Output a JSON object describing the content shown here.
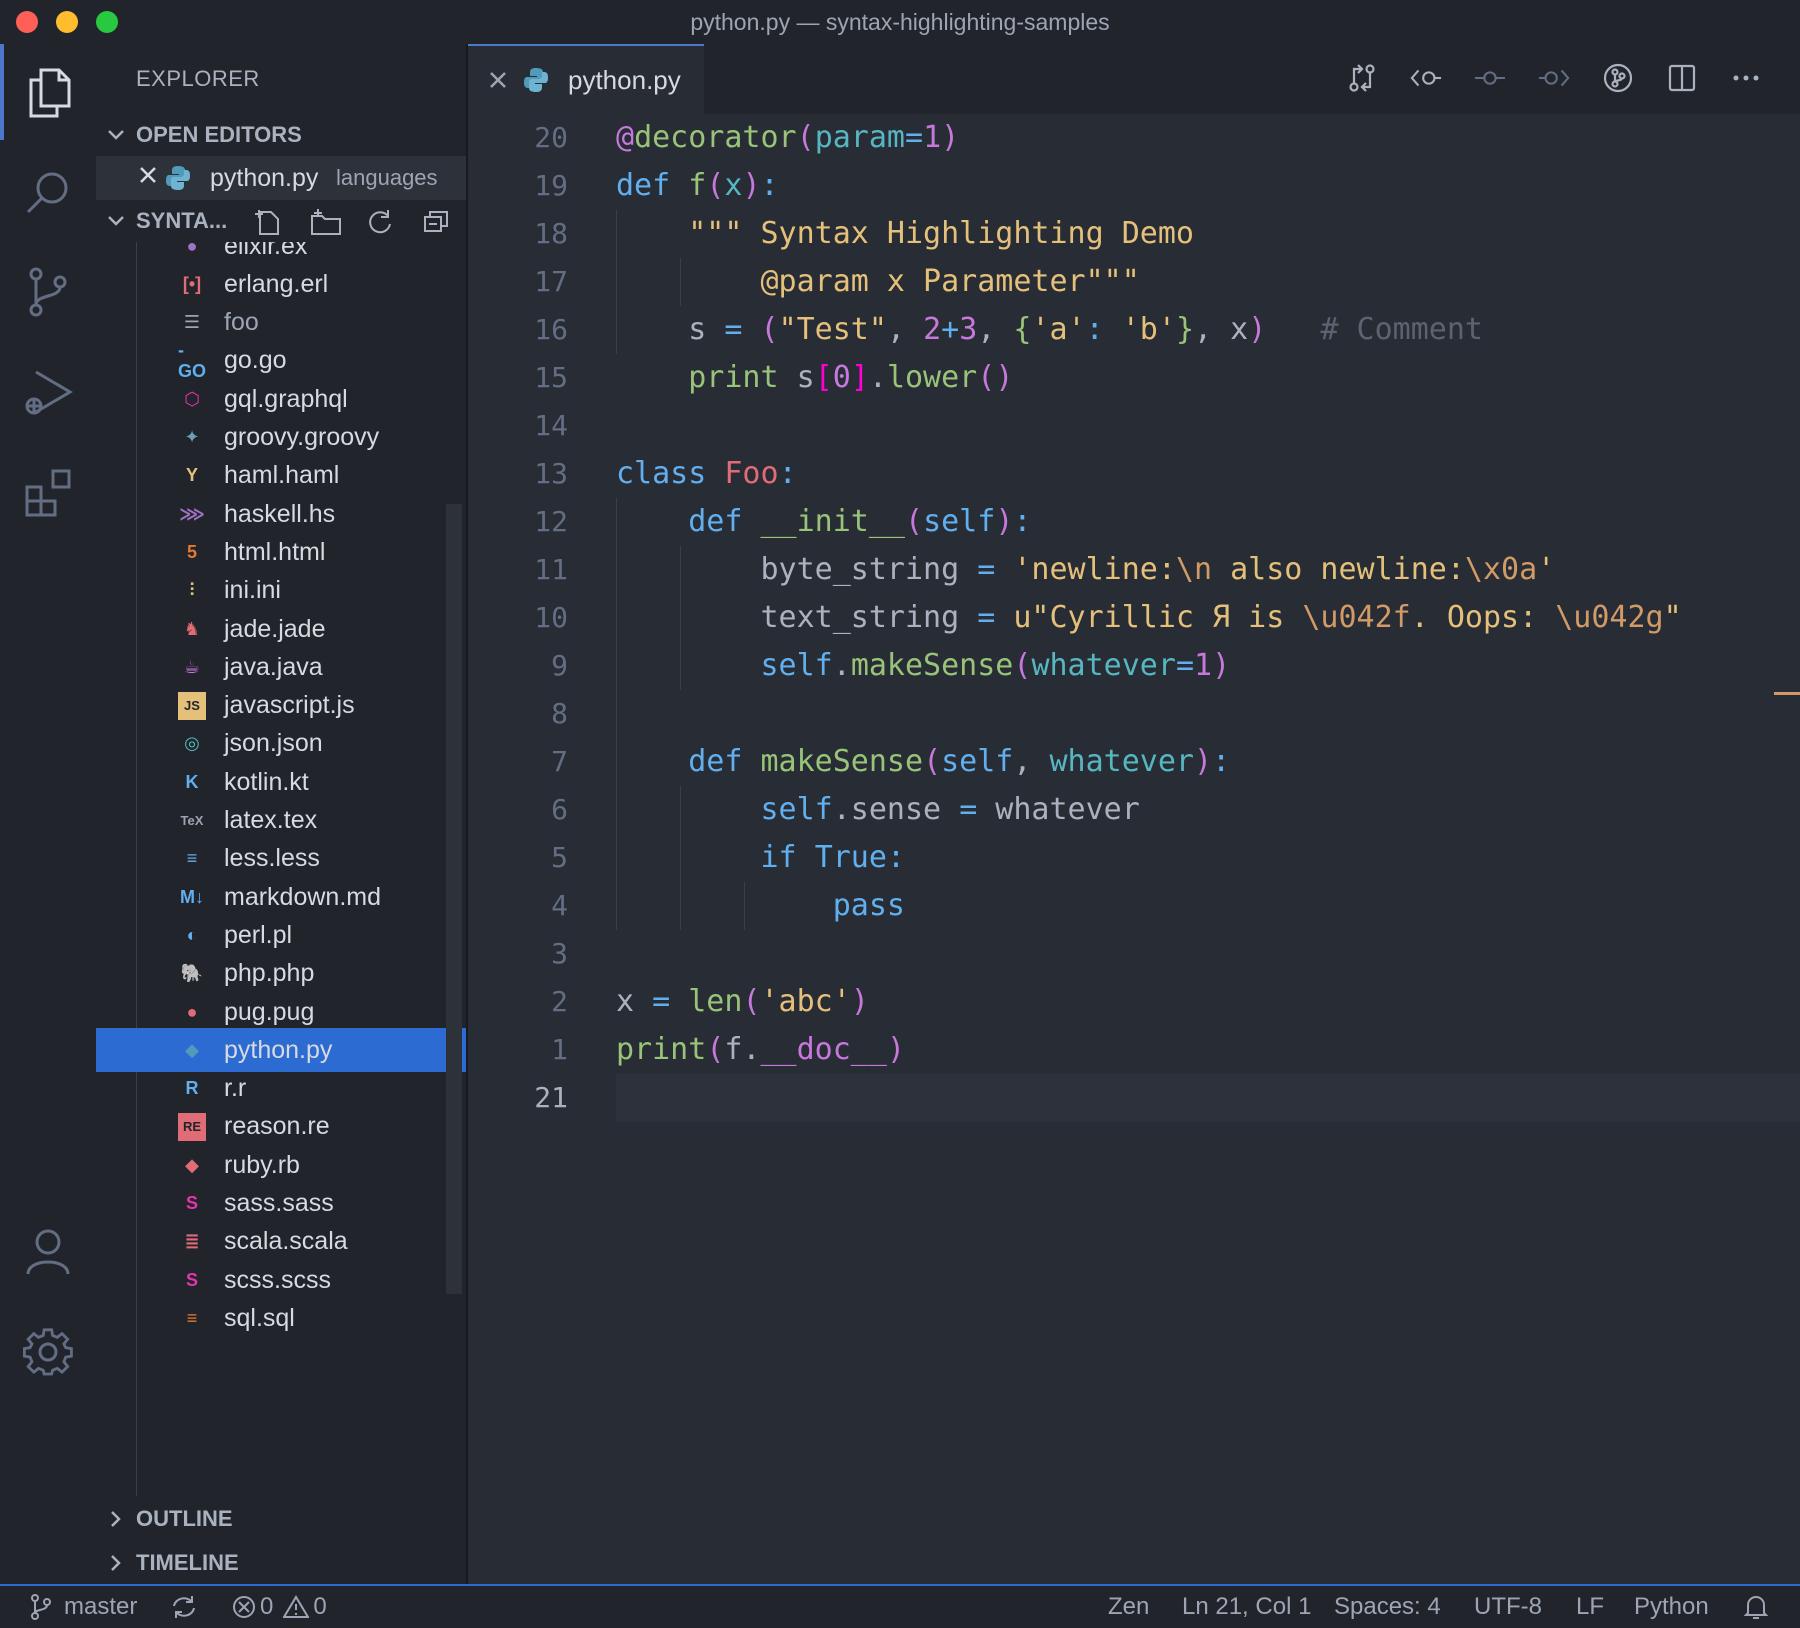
{
  "window": {
    "title": "python.py — syntax-highlighting-samples",
    "traffic_colors": [
      "#fe5f57",
      "#febc2e",
      "#28c840"
    ]
  },
  "activity_bar": {
    "items": [
      "explorer-icon",
      "search-icon",
      "source-control-icon",
      "run-debug-icon",
      "extensions-icon"
    ],
    "bottom": [
      "account-icon",
      "settings-gear-icon"
    ]
  },
  "sidebar": {
    "title": "EXPLORER",
    "open_editors": {
      "label": "OPEN EDITORS",
      "items": [
        {
          "name": "python.py",
          "desc": "languages"
        }
      ]
    },
    "project": {
      "label": "SYNTA...",
      "actions": [
        "new-file-icon",
        "new-folder-icon",
        "refresh-icon",
        "collapse-all-icon"
      ],
      "files": [
        {
          "name": "elixir.ex",
          "icon": "drop",
          "color": "#a074c4"
        },
        {
          "name": "erlang.erl",
          "icon": "bracket",
          "color": "#e06c75"
        },
        {
          "name": "foo",
          "icon": "doc",
          "color": "#9da5b4"
        },
        {
          "name": "go.go",
          "icon": "go",
          "color": "#61afef"
        },
        {
          "name": "gql.graphql",
          "icon": "hex",
          "color": "#e535ab"
        },
        {
          "name": "groovy.groovy",
          "icon": "star",
          "color": "#6a9fb5"
        },
        {
          "name": "haml.haml",
          "icon": "haml",
          "color": "#e5c07b"
        },
        {
          "name": "haskell.hs",
          "icon": "lambda",
          "color": "#a074c4"
        },
        {
          "name": "html.html",
          "icon": "html5",
          "color": "#e37933"
        },
        {
          "name": "ini.ini",
          "icon": "sliders",
          "color": "#e5c07b"
        },
        {
          "name": "jade.jade",
          "icon": "jade",
          "color": "#e06c75"
        },
        {
          "name": "java.java",
          "icon": "java",
          "color": "#c678dd"
        },
        {
          "name": "javascript.js",
          "icon": "JS",
          "color": "#e5c07b"
        },
        {
          "name": "json.json",
          "icon": "json",
          "color": "#56b6c2"
        },
        {
          "name": "kotlin.kt",
          "icon": "K",
          "color": "#61afef"
        },
        {
          "name": "latex.tex",
          "icon": "TeX",
          "color": "#9da5b4"
        },
        {
          "name": "less.less",
          "icon": "less",
          "color": "#61afef"
        },
        {
          "name": "markdown.md",
          "icon": "M",
          "color": "#61afef"
        },
        {
          "name": "perl.pl",
          "icon": "perl",
          "color": "#61afef"
        },
        {
          "name": "php.php",
          "icon": "php",
          "color": "#61afef"
        },
        {
          "name": "pug.pug",
          "icon": "pug",
          "color": "#e06c75"
        },
        {
          "name": "python.py",
          "icon": "py",
          "color": "#519aba",
          "selected": true
        },
        {
          "name": "r.r",
          "icon": "R",
          "color": "#61afef"
        },
        {
          "name": "reason.re",
          "icon": "RE",
          "color": "#e06c75"
        },
        {
          "name": "ruby.rb",
          "icon": "ruby",
          "color": "#e06c75"
        },
        {
          "name": "sass.sass",
          "icon": "sass",
          "color": "#e535ab"
        },
        {
          "name": "scala.scala",
          "icon": "scala",
          "color": "#e06c75"
        },
        {
          "name": "scss.scss",
          "icon": "scss",
          "color": "#e535ab"
        },
        {
          "name": "sql.sql",
          "icon": "sql",
          "color": "#e37933"
        }
      ]
    },
    "outline_label": "OUTLINE",
    "timeline_label": "TIMELINE"
  },
  "editor": {
    "tab": {
      "label": "python.py"
    },
    "actions": [
      "compare-changes-icon",
      "previous-change-icon",
      "git-commit-icon",
      "next-change-icon",
      "git-history-icon",
      "split-editor-icon",
      "more-actions-icon"
    ],
    "line_numbers": [
      "20",
      "19",
      "18",
      "17",
      "16",
      "15",
      "14",
      "13",
      "12",
      "11",
      "10",
      "9",
      "8",
      "7",
      "6",
      "5",
      "4",
      "3",
      "2",
      "1",
      "21"
    ],
    "current_line_index": 20,
    "code_lines": [
      "@decorator(param=1)",
      "def f(x):",
      "    \"\"\" Syntax Highlighting Demo",
      "        @param x Parameter\"\"\"",
      "    s = (\"Test\", 2+3, {'a': 'b'}, x)   # Comment",
      "    print s[0].lower()",
      "",
      "class Foo:",
      "    def __init__(self):",
      "        byte_string = 'newline:\\n also newline:\\x0a'",
      "        text_string = u\"Cyrillic Я is \\u042f. Oops: \\u042g\"",
      "        self.makeSense(whatever=1)",
      "",
      "    def makeSense(self, whatever):",
      "        self.sense = whatever",
      "        if True:",
      "            pass",
      "",
      "x = len('abc')",
      "print(f.__doc__)",
      ""
    ]
  },
  "status_bar": {
    "branch": "master",
    "errors": "0",
    "warnings": "0",
    "zen": "Zen",
    "position": "Ln 21, Col 1",
    "spaces": "Spaces: 4",
    "encoding": "UTF-8",
    "eol": "LF",
    "language": "Python"
  }
}
